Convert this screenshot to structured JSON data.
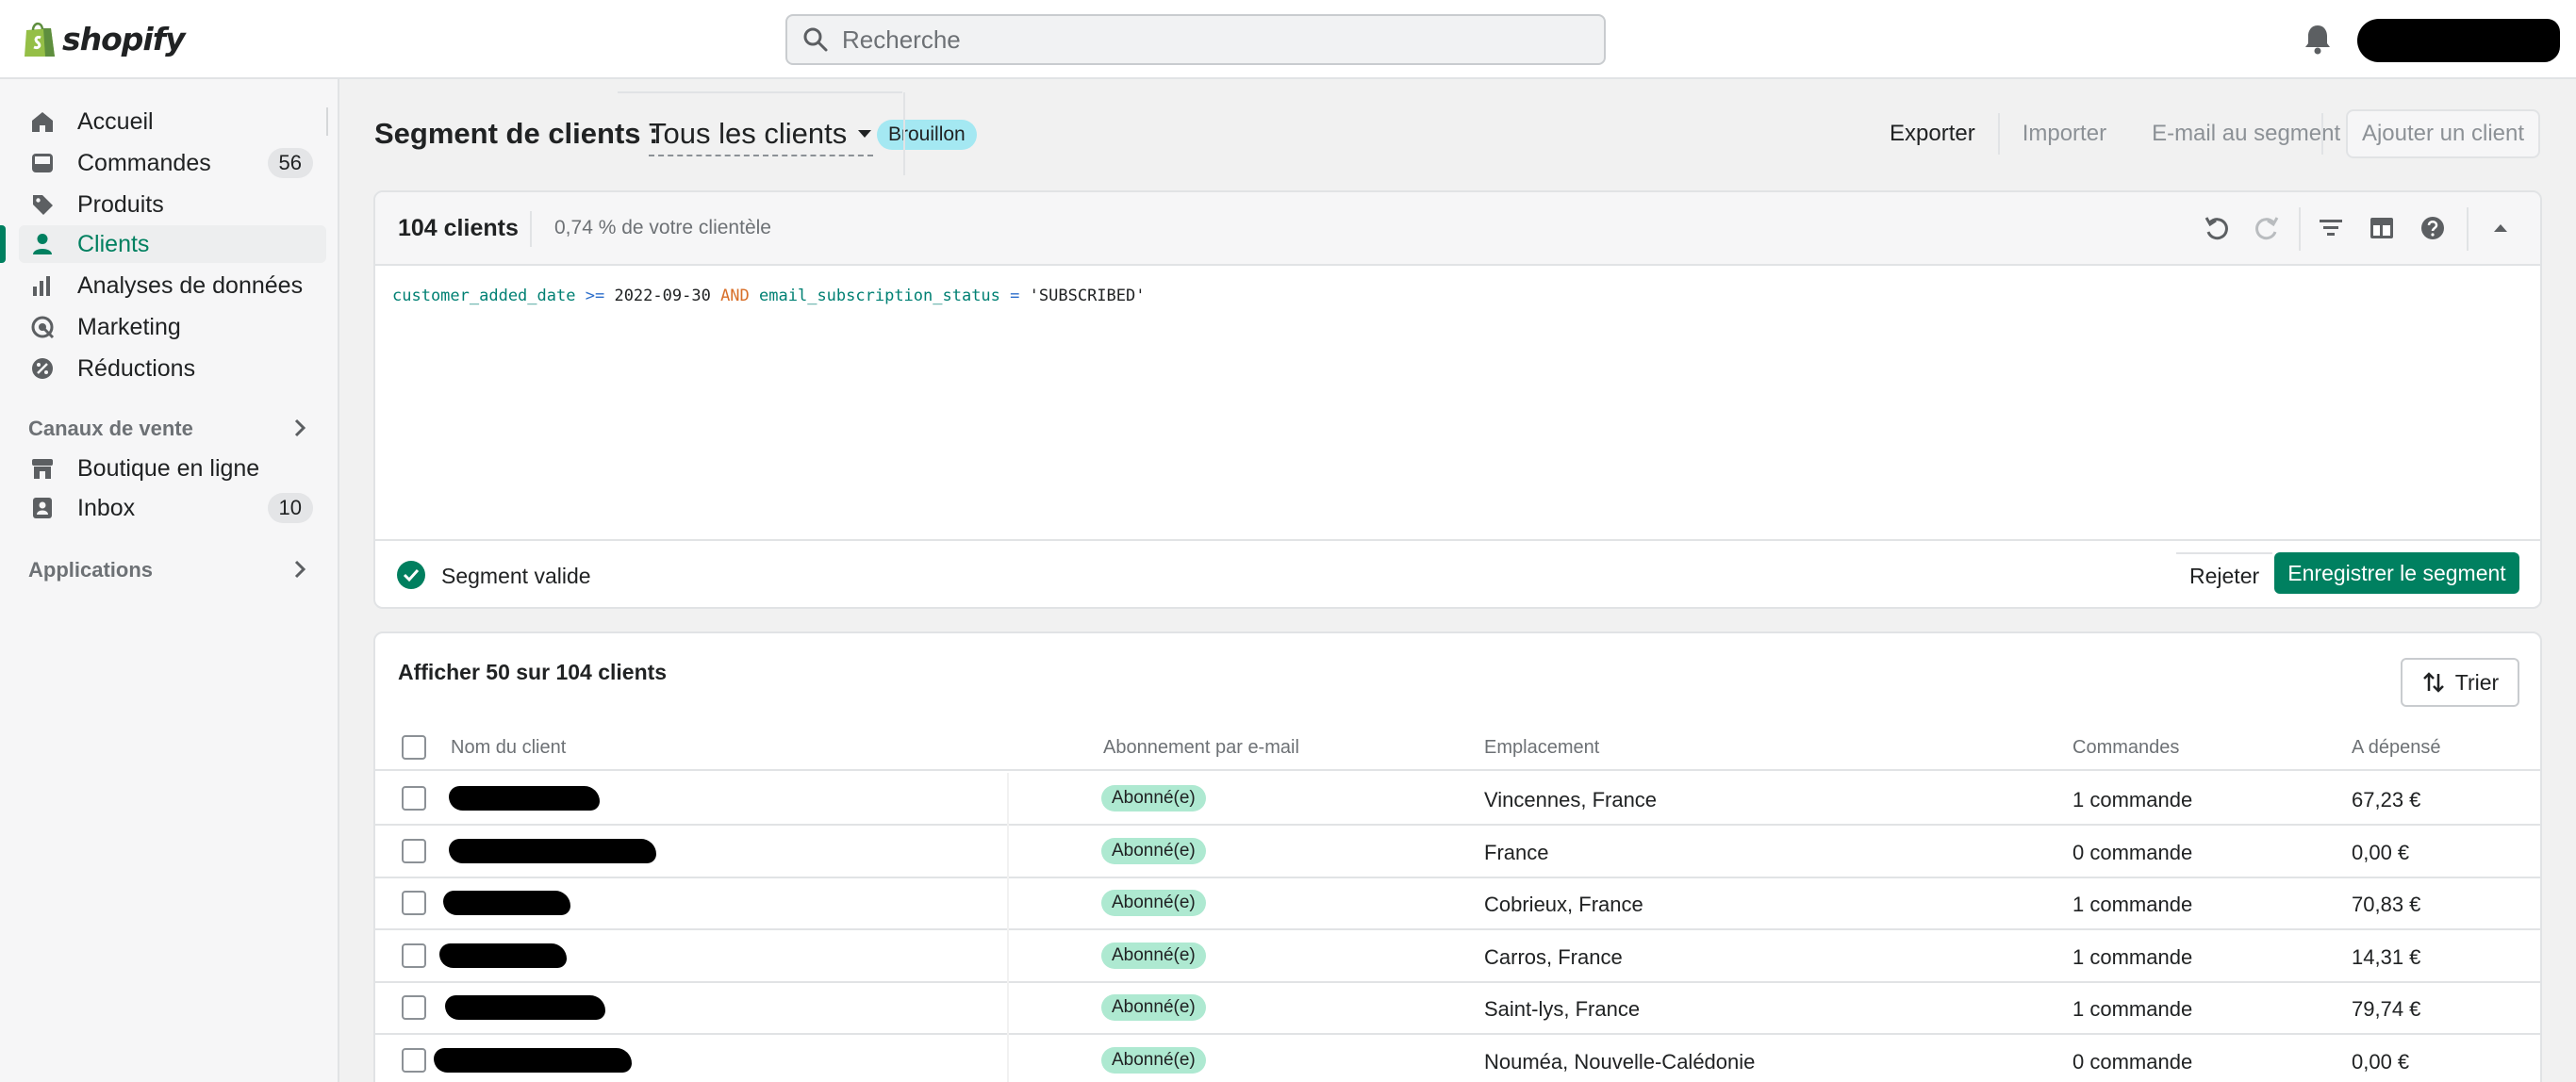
{
  "app": {
    "name": "shopify"
  },
  "topbar": {
    "search_placeholder": "Recherche"
  },
  "sidebar": {
    "items": [
      {
        "label": "Accueil",
        "icon": "home-icon"
      },
      {
        "label": "Commandes",
        "icon": "orders-icon",
        "badge": "56"
      },
      {
        "label": "Produits",
        "icon": "tag-icon"
      },
      {
        "label": "Clients",
        "icon": "person-icon",
        "active": true
      },
      {
        "label": "Analyses de données",
        "icon": "analytics-icon"
      },
      {
        "label": "Marketing",
        "icon": "marketing-icon"
      },
      {
        "label": "Réductions",
        "icon": "discount-icon"
      }
    ],
    "sales_channels_title": "Canaux de vente",
    "channels": [
      {
        "label": "Boutique en ligne",
        "icon": "store-icon"
      },
      {
        "label": "Inbox",
        "icon": "inbox-icon",
        "badge": "10"
      }
    ],
    "apps_title": "Applications"
  },
  "header": {
    "title": "Segment de clients :",
    "segment_name": "Tous les clients",
    "status": "Brouillon",
    "actions": [
      "Exporter",
      "Importer",
      "E-mail au segment"
    ],
    "add_client": "Ajouter un client"
  },
  "editor": {
    "count": "104 clients",
    "share": "0,74 % de votre clientèle",
    "query": {
      "field1": "customer_added_date",
      "op1": ">=",
      "value1": "2022-09-30",
      "keyword": "AND",
      "field2": "email_subscription_status",
      "op2": "=",
      "value2": "'SUBSCRIBED'"
    },
    "valid_text": "Segment valide",
    "reject": "Rejeter",
    "save": "Enregistrer le segment"
  },
  "table": {
    "title": "Afficher 50 sur 104 clients",
    "sort": "Trier",
    "columns": [
      "Nom du client",
      "Abonnement par e-mail",
      "Emplacement",
      "Commandes",
      "A dépensé"
    ],
    "rows": [
      {
        "subscription": "Abonné(e)",
        "location": "Vincennes, France",
        "orders": "1 commande",
        "spent": "67,23 €"
      },
      {
        "subscription": "Abonné(e)",
        "location": "France",
        "orders": "0 commande",
        "spent": "0,00 €"
      },
      {
        "subscription": "Abonné(e)",
        "location": "Cobrieux, France",
        "orders": "1 commande",
        "spent": "70,83 €"
      },
      {
        "subscription": "Abonné(e)",
        "location": "Carros, France",
        "orders": "1 commande",
        "spent": "14,31 €"
      },
      {
        "subscription": "Abonné(e)",
        "location": "Saint-lys, France",
        "orders": "1 commande",
        "spent": "79,74 €"
      },
      {
        "subscription": "Abonné(e)",
        "location": "Nouméa, Nouvelle-Calédonie",
        "orders": "0 commande",
        "spent": "0,00 €"
      }
    ]
  },
  "colors": {
    "accent": "#008060",
    "badge_info": "#a4e8f2",
    "badge_success": "#aee9d1"
  }
}
